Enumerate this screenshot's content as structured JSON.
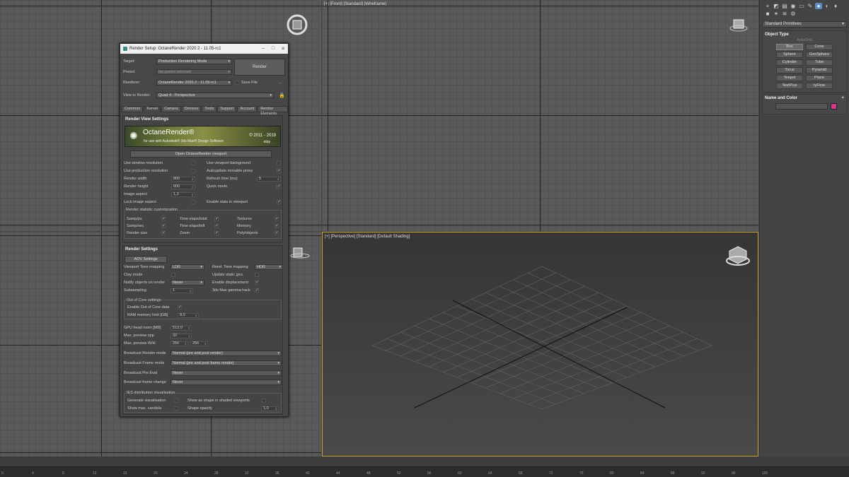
{
  "viewports": {
    "front_label": "[+] [Front] [Standard] [Wireframe]",
    "persp_label": "[+] [Perspective] [Standard] [Default Shading]",
    "top_cube_label": "TOP",
    "left_cube_label": "LEFT",
    "front_cube_label": "FRONT"
  },
  "command_panel": {
    "dropdown": "Standard Primitives",
    "object_type_title": "Object Type",
    "autogrid": "AutoGrid",
    "buttons": [
      "Box",
      "Cone",
      "Sphere",
      "GeoSphere",
      "Cylinder",
      "Tube",
      "Torus",
      "Pyramid",
      "Teapot",
      "Plane",
      "TextPlus",
      "tyFlow"
    ],
    "name_color_title": "Name and Color",
    "swatch_color": "#d4398a"
  },
  "dialog": {
    "title": "Render Setup: OctaneRender 2020.2 - 11.05-rc1",
    "target_label": "Target:",
    "target_value": "Production Rendering Mode",
    "preset_label": "Preset:",
    "preset_value": "No preset selected",
    "renderer_label": "Renderer:",
    "renderer_value": "OctaneRender 2020.2 - 11.05-rc1",
    "save_file": "Save File",
    "dots": "...",
    "view_label": "View to Render:",
    "view_value": "Quad 4 - Perspective",
    "render_button": "Render",
    "tabs": [
      "Common",
      "Kernel",
      "Camera",
      "Devices",
      "Tools",
      "Support",
      "Account",
      "Render Elements"
    ],
    "rvs_title": "Render View Settings",
    "banner_title": "OctaneRender®",
    "banner_sub": "for use with Autodesk® 3ds Max® Design Software",
    "banner_years": "© 2011 - 2019",
    "banner_otoy": "otoy",
    "open_viewport": "Open OctaneRender viewport",
    "left_opts": [
      "Use window resolution",
      "Use production resolution",
      "Render width",
      "Render height",
      "Image aspect",
      "Lock image aspect"
    ],
    "left_vals": [
      "800",
      "600",
      "1,3"
    ],
    "right_opts": [
      "Use viewport background",
      "Autoupdate movable proxy",
      "Refresh time (ms)",
      "Quick mode",
      "",
      "Enable stats in viewport"
    ],
    "refresh_val": "5",
    "stat_title": "Render statistic customization",
    "stats": [
      "Samp/px",
      "Time elaps/total",
      "Textures",
      "Samp/sec",
      "Time elaps/left",
      "Memory",
      "Render size",
      "Zoom",
      "Poly/objects"
    ],
    "rs_title": "Render Settings",
    "aov": "AOV Settings",
    "vtm_label": "Viewport Tone mapping",
    "vtm_val": "LDR",
    "rtm_label": "Rend. Tone mapping",
    "rtm_val": "HDR",
    "clay": "Clay mode",
    "update_static": "Update static geo.",
    "notify_label": "Notify objects on render",
    "notify_val": "Never",
    "enable_disp": "Enable displacement",
    "subsampling": "Subsampling",
    "subsampling_val": "1",
    "gamma_hack": "3ds Max gamma hack",
    "ooc_title": "Out of Core settings",
    "ooc_enable": "Enable Out of Core data",
    "ram_label": "RAM memory limit [GB]",
    "ram_val": "8,0",
    "gpu_label": "GPU head room [MB]",
    "gpu_val": "512,0",
    "mps_label": "Max. preview spp",
    "mps_val": "32",
    "mpwh_label": "Max. preview W/H",
    "mpwh_w": "256",
    "mpwh_h": "256",
    "brm_label": "Broadcast Render mode",
    "brm_val": "Normal (pre and post render)",
    "bfm_label": "Broadcast Frame mode",
    "bfm_val": "Normal (pre and post frame render)",
    "bpe_label": "Broadcast Pre Eval",
    "bpe_val": "Never",
    "bfc_label": "Broadcast frame change",
    "bfc_val": "Never",
    "ies_title": "IES distribution visualisation",
    "gen_vis": "Generate visualisation",
    "show_shape": "Show as shape in shaded viewports",
    "show_max": "Show max. candela",
    "shape_opacity": "Shape opacity",
    "shape_opacity_val": "1,0"
  },
  "ruler": [
    "0",
    "4",
    "8",
    "12",
    "16",
    "20",
    "24",
    "28",
    "32",
    "36",
    "40",
    "44",
    "48",
    "52",
    "56",
    "60",
    "64",
    "68",
    "72",
    "76",
    "80",
    "84",
    "88",
    "92",
    "96",
    "100"
  ]
}
